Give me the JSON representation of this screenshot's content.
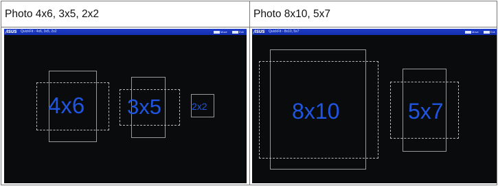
{
  "cells": [
    {
      "heading": "Photo 4x6, 3x5, 2x2",
      "window_title": "QuickFit - 4x6, 3x5, 2x2",
      "logo": "/ISUS",
      "buttons": [
        "Move",
        "Exit"
      ],
      "labels": [
        "4x6",
        "3x5",
        "2x2"
      ]
    },
    {
      "heading": "Photo 8x10, 5x7",
      "window_title": "QuickFit - 8x10, 5x7",
      "logo": "/ISUS",
      "buttons": [
        "Move",
        "Exit"
      ],
      "labels": [
        "8x10",
        "5x7"
      ]
    }
  ],
  "colors": {
    "screen_bg": "#0a0b0c",
    "titlebar": "#1a36bd",
    "label": "#1f55e0"
  }
}
